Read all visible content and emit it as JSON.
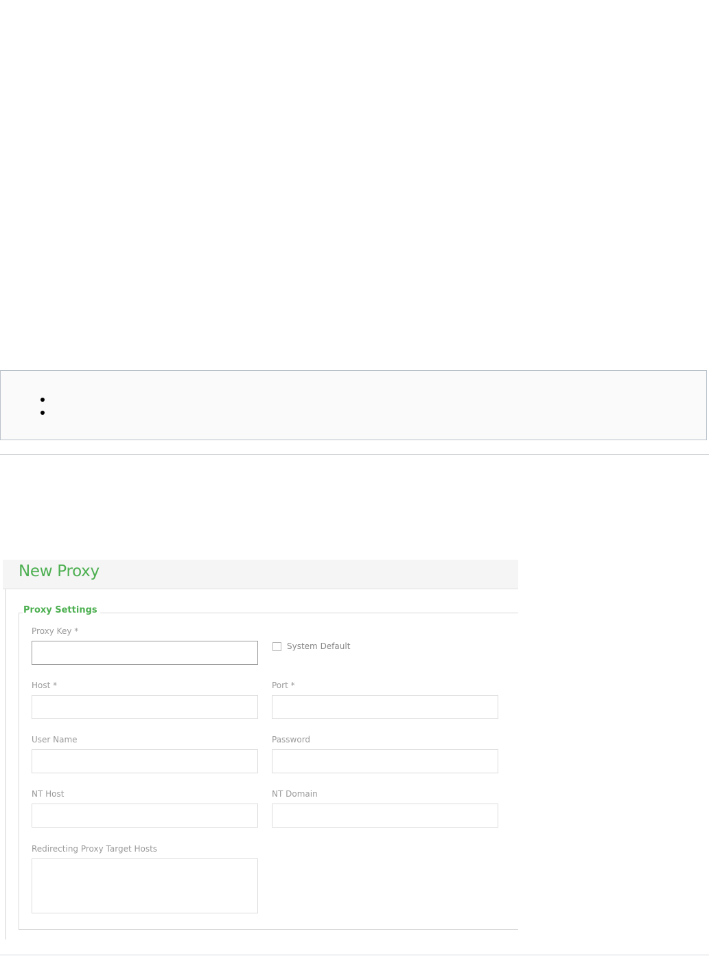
{
  "page": {
    "info_list": [
      "",
      ""
    ]
  },
  "form": {
    "title": "New Proxy",
    "section_title": "Proxy Settings",
    "fields": {
      "proxy_key": {
        "label": "Proxy Key *",
        "value": ""
      },
      "system_default": {
        "label": "System Default",
        "checked": false
      },
      "host": {
        "label": "Host *",
        "value": ""
      },
      "port": {
        "label": "Port *",
        "value": ""
      },
      "user_name": {
        "label": "User Name",
        "value": ""
      },
      "password": {
        "label": "Password",
        "value": ""
      },
      "nt_host": {
        "label": "NT Host",
        "value": ""
      },
      "nt_domain": {
        "label": "NT Domain",
        "value": ""
      },
      "redirecting_hosts": {
        "label": "Redirecting Proxy Target Hosts",
        "value": ""
      }
    }
  },
  "colors": {
    "accent": "#4caf50",
    "label": "#9a9a9a",
    "border": "#dcdcdc",
    "info_box_border": "#b8c0c8"
  }
}
